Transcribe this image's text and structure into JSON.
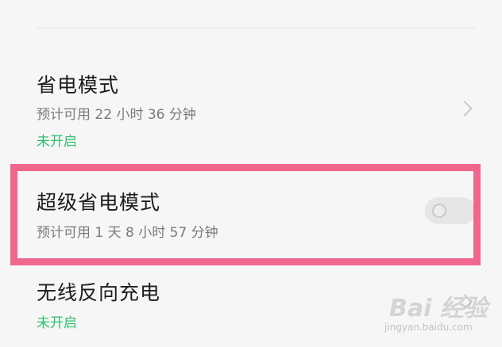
{
  "settings": {
    "items": [
      {
        "title": "省电模式",
        "subtitle": "预计可用 22 小时 36 分钟",
        "status": "未开启",
        "control": "chevron-right-icon"
      },
      {
        "title": "超级省电模式",
        "subtitle": "预计可用 1 天 8 小时 57 分钟",
        "control": "toggle",
        "toggle_on": false,
        "highlighted": true
      },
      {
        "title": "无线反向充电",
        "status": "未开启",
        "control": "chevron-right-icon"
      }
    ]
  },
  "watermark": {
    "logo": "Bai 经验",
    "url": "jingyan.baidu.com"
  },
  "colors": {
    "background": "#f6f6f6",
    "status_green": "#2fbf71",
    "highlight_pink": "#f0668d",
    "title_text": "#1c1c1c",
    "subtitle_text": "#7a7a7a"
  }
}
